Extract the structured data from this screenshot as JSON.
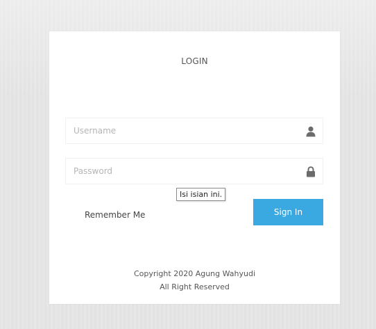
{
  "login": {
    "title": "LOGIN",
    "username_placeholder": "Username",
    "password_placeholder": "Password",
    "tooltip": "Isi isian ini.",
    "remember_label": "Remember Me",
    "signin_label": "Sign In",
    "copyright_line1": "Copyright 2020 Agung Wahyudi",
    "copyright_line2": "All Right Reserved"
  },
  "icons": {
    "username": "user-icon",
    "password": "lock-icon"
  },
  "colors": {
    "signin_button": "#3aa9e1",
    "background": "#e4e4e4",
    "card": "#ffffff"
  }
}
